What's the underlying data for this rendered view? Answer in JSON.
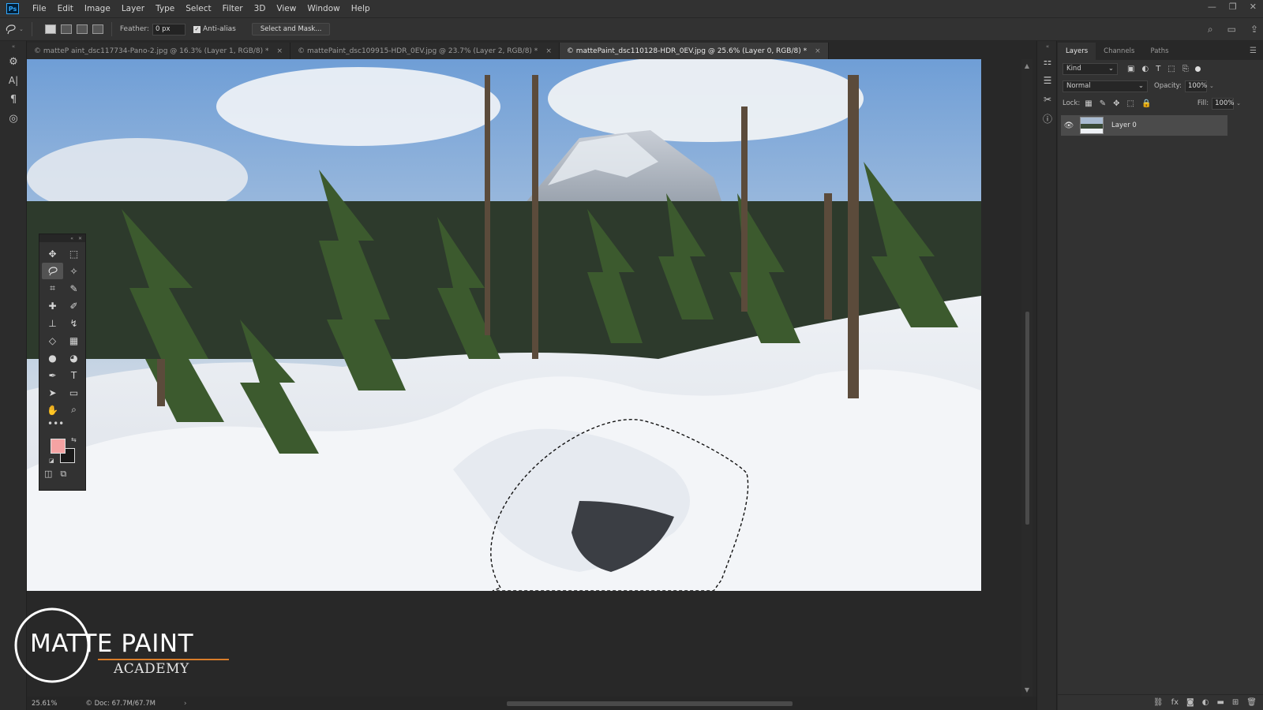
{
  "app": {
    "logo_text": "Ps"
  },
  "menu": [
    "File",
    "Edit",
    "Image",
    "Layer",
    "Type",
    "Select",
    "Filter",
    "3D",
    "View",
    "Window",
    "Help"
  ],
  "window_controls": [
    "—",
    "❐",
    "✕"
  ],
  "options_bar": {
    "feather_label": "Feather:",
    "feather_value": "0 px",
    "antialias_label": "Anti-alias",
    "select_mask_label": "Select and Mask..."
  },
  "tabs": [
    {
      "label": "© matteP aint_dsc117734-Pano-2.jpg @ 16.3% (Layer 1, RGB/8) *",
      "active": false
    },
    {
      "label": "© mattePaint_dsc109915-HDR_0EV.jpg @ 23.7% (Layer 2, RGB/8) *",
      "active": false
    },
    {
      "label": "© mattePaint_dsc110128-HDR_0EV.jpg @ 25.6% (Layer 0, RGB/8) *",
      "active": true
    }
  ],
  "status": {
    "zoom": "25.61%",
    "doc": "© Doc: 67.7M/67.7M",
    "arrow": "›"
  },
  "tools": {
    "foreground_color": "#f4a3a3",
    "background_color": "#1a1a1a",
    "more_label": "•••"
  },
  "layers_panel": {
    "tabs": [
      "Layers",
      "Channels",
      "Paths"
    ],
    "kind_label": "Kind",
    "blend_mode": "Normal",
    "opacity_label": "Opacity:",
    "opacity_value": "100%",
    "lock_label": "Lock:",
    "fill_label": "Fill:",
    "fill_value": "100%",
    "layers": [
      {
        "name": "Layer 0",
        "visible": true
      }
    ]
  },
  "logo": {
    "line1": "MATTE PAINT",
    "line2": "ACADEMY"
  }
}
